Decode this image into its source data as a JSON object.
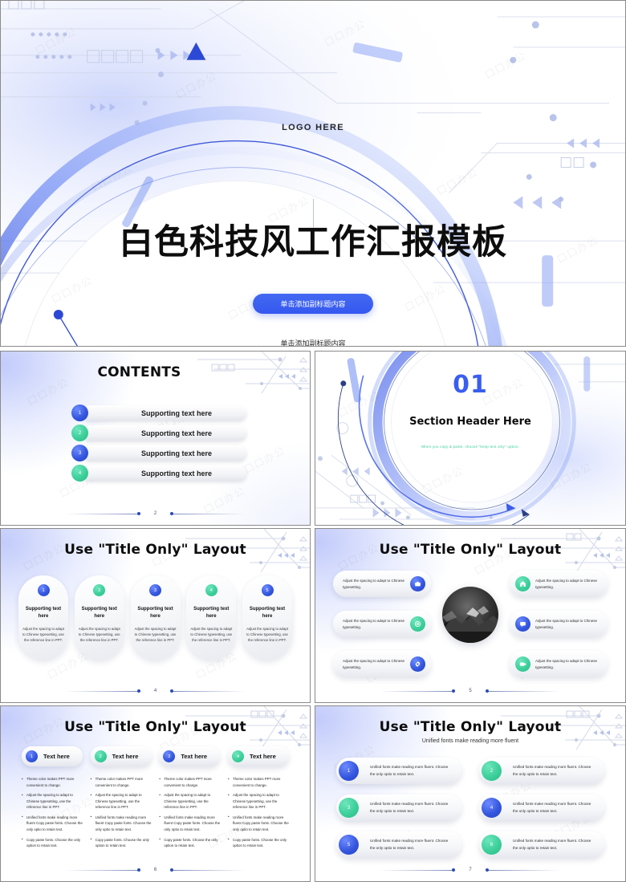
{
  "colors": {
    "blue": "#3355dd",
    "green": "#3ccf9a",
    "title": "#0d0d0d",
    "accent_button": "#3558ef"
  },
  "slide1": {
    "logo": "LOGO HERE",
    "title": "白色科技风工作汇报模板",
    "button": "单击添加副标题内容",
    "subtitle": "单击添加副标题内容"
  },
  "slide2": {
    "title": "CONTENTS",
    "page": "2",
    "items": [
      {
        "num": "1",
        "label": "Supporting text here",
        "color": "blue"
      },
      {
        "num": "2",
        "label": "Supporting text here",
        "color": "green"
      },
      {
        "num": "3",
        "label": "Supporting text here",
        "color": "blue"
      },
      {
        "num": "4",
        "label": "Supporting text here",
        "color": "green"
      }
    ]
  },
  "slide3": {
    "number": "01",
    "header": "Section Header Here",
    "note": "When you copy & paste, choose \"keep text only\" option."
  },
  "slide4": {
    "title": "Use \"Title Only\" Layout",
    "page": "4",
    "items": [
      {
        "num": "1",
        "color": "blue",
        "heading": "Supporting text here",
        "body": "Adjust the spacing to adapt to Chinese typesetting, use the reference line in PPT."
      },
      {
        "num": "2",
        "color": "green",
        "heading": "Supporting text here",
        "body": "Adjust the spacing to adapt to Chinese typesetting, use the reference line in PPT."
      },
      {
        "num": "3",
        "color": "blue",
        "heading": "Supporting text here",
        "body": "Adjust the spacing to adapt to Chinese typesetting, use the reference line in PPT."
      },
      {
        "num": "4",
        "color": "green",
        "heading": "Supporting text here",
        "body": "Adjust the spacing to adapt to Chinese typesetting, use the reference line in PPT."
      },
      {
        "num": "5",
        "color": "blue",
        "heading": "Supporting text here",
        "body": "Adjust the spacing to adapt to Chinese typesetting, use the reference line in PPT."
      }
    ]
  },
  "slide5": {
    "title": "Use \"Title Only\" Layout",
    "page": "5",
    "left": [
      {
        "icon": "briefcase-icon",
        "color": "blue",
        "text": "Adjust the spacing to adapt to Chinese typesetting."
      },
      {
        "icon": "target-icon",
        "color": "green",
        "text": "Adjust the spacing to adapt to Chinese typesetting."
      },
      {
        "icon": "gear-icon",
        "color": "blue",
        "text": "Adjust the spacing to adapt to Chinese typesetting."
      }
    ],
    "right": [
      {
        "icon": "home-icon",
        "color": "green",
        "text": "Adjust the spacing to adapt to Chinese typesetting."
      },
      {
        "icon": "chat-icon",
        "color": "blue",
        "text": "Adjust the spacing to adapt to Chinese typesetting."
      },
      {
        "icon": "camera-icon",
        "color": "green",
        "text": "Adjust the spacing to adapt to Chinese typesetting."
      }
    ]
  },
  "slide6": {
    "title": "Use \"Title Only\" Layout",
    "page": "6",
    "columns": [
      {
        "num": "1",
        "color": "blue",
        "label": "Text here",
        "bullets": [
          "Theme  color makes PPT more convenient to change.",
          "Adjust the spacing to adapt to Chinese typesetting, use the reference line in PPT.",
          "Unified fonts make reading more fluent Copy paste fonts. Choose the only optio to retain text.",
          "Copy paste  fonts. Choose the only option to retain text."
        ]
      },
      {
        "num": "2",
        "color": "green",
        "label": "Text here",
        "bullets": [
          "Theme  color makes PPT more convenient to change.",
          "Adjust the spacing to adapt to Chinese typesetting, use the reference line in PPT.",
          "Unified fonts make reading more fluent Copy paste fonts. Choose the only optio to retain text.",
          "Copy paste  fonts. Choose the only option to retain text."
        ]
      },
      {
        "num": "3",
        "color": "blue",
        "label": "Text here",
        "bullets": [
          "Theme  color makes PPT more convenient to change.",
          "Adjust the spacing to adapt to Chinese typesetting, use the reference line in PPT.",
          "Unified fonts make reading more fluent Copy paste fonts. Choose the only optio to retain text.",
          "Copy paste  fonts. Choose the only option to retain text."
        ]
      },
      {
        "num": "4",
        "color": "green",
        "label": "Text here",
        "bullets": [
          "Theme  color makes PPT more convenient to change.",
          "Adjust the spacing to adapt to Chinese typesetting, use the reference line in PPT.",
          "Unified fonts make reading more fluent Copy paste fonts. Choose the only optio to retain text.",
          "Copy paste  fonts. Choose the only option to retain text."
        ]
      }
    ]
  },
  "slide7": {
    "title": "Use \"Title Only\" Layout",
    "subtitle": "Unified fonts make reading more fluent",
    "page": "7",
    "items": [
      {
        "num": "1",
        "color": "blue",
        "text": "Unified fonts make reading more fluent. Choose the only optio to retain text."
      },
      {
        "num": "2",
        "color": "green",
        "text": "Unified fonts make reading more fluent. Choose the only optio to retain text."
      },
      {
        "num": "3",
        "color": "green",
        "text": "Unified fonts make reading more fluent. Choose the only optio to retain text."
      },
      {
        "num": "4",
        "color": "blue",
        "text": "Unified fonts make reading more fluent. Choose the only optio to retain text."
      },
      {
        "num": "5",
        "color": "blue",
        "text": "Unified fonts make reading more fluent. Choose the only optio to retain text."
      },
      {
        "num": "6",
        "color": "green",
        "text": "Unified fonts make reading more fluent. Choose the only optio to retain text."
      }
    ]
  },
  "watermark": "口口办公"
}
